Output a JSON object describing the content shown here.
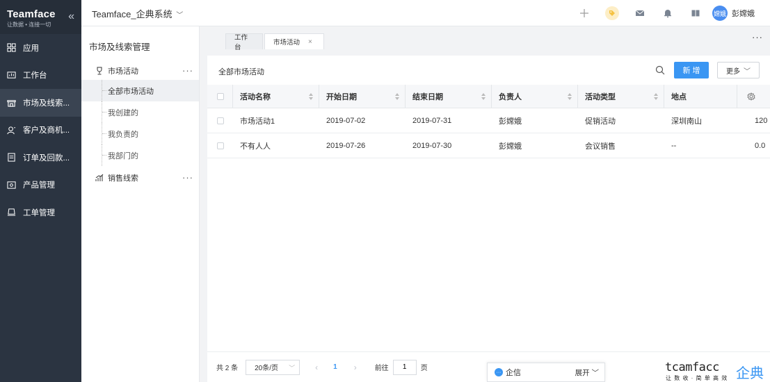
{
  "brand": {
    "name": "Teamface",
    "slogan": "让数据 • 连接一切"
  },
  "nav": {
    "items": [
      {
        "label": "应用",
        "icon": "grid-icon",
        "active": false
      },
      {
        "label": "工作台",
        "icon": "dashboard-icon",
        "active": false
      },
      {
        "label": "市场及线索...",
        "icon": "store-icon",
        "active": true
      },
      {
        "label": "客户及商机...",
        "icon": "customer-icon",
        "active": false
      },
      {
        "label": "订单及回款...",
        "icon": "order-icon",
        "active": false
      },
      {
        "label": "产品管理",
        "icon": "product-icon",
        "active": false
      },
      {
        "label": "工单管理",
        "icon": "ticket-icon",
        "active": false
      }
    ]
  },
  "topbar": {
    "system_title": "Teamface_企典系统",
    "user_avatar": "嫦娥",
    "user_name": "彭嫦娥",
    "tag_color": "#f5c242"
  },
  "submenu": {
    "title": "市场及线索管理",
    "group1": {
      "label": "市场活动",
      "more": "···"
    },
    "items": [
      "全部市场活动",
      "我创建的",
      "我负责的",
      "我部门的"
    ],
    "group2": {
      "label": "销售线索",
      "more": "···"
    }
  },
  "tabs": {
    "tab1": "工作台",
    "tab2": "市场活动",
    "close": "×",
    "more": "···"
  },
  "card": {
    "title": "全部市场活动",
    "new_label": "新 增",
    "more_label": "更多"
  },
  "table": {
    "columns": [
      "活动名称",
      "开始日期",
      "结束日期",
      "负责人",
      "活动类型",
      "地点"
    ],
    "rows": [
      {
        "name": "市场活动1",
        "start": "2019-07-02",
        "end": "2019-07-31",
        "owner": "彭嫦娥",
        "type": "促销活动",
        "place": "深圳南山",
        "extra": "120"
      },
      {
        "name": "不有人人",
        "start": "2019-07-26",
        "end": "2019-07-30",
        "owner": "彭嫦娥",
        "type": "会议销售",
        "place": "--",
        "extra": "0.0"
      }
    ]
  },
  "pager": {
    "total": "共 2 条",
    "size": "20条/页",
    "prev": "‹",
    "current": "1",
    "next": "›",
    "goto": "前往",
    "goto_value": "1",
    "page": "页"
  },
  "chat": {
    "name": "企信",
    "toggle": "展开"
  },
  "watermark": {
    "en": "tcamfacc",
    "cn": "企典",
    "slogan": "让 数 收 · 简 单 高 效"
  },
  "accent": "#3a96f3"
}
